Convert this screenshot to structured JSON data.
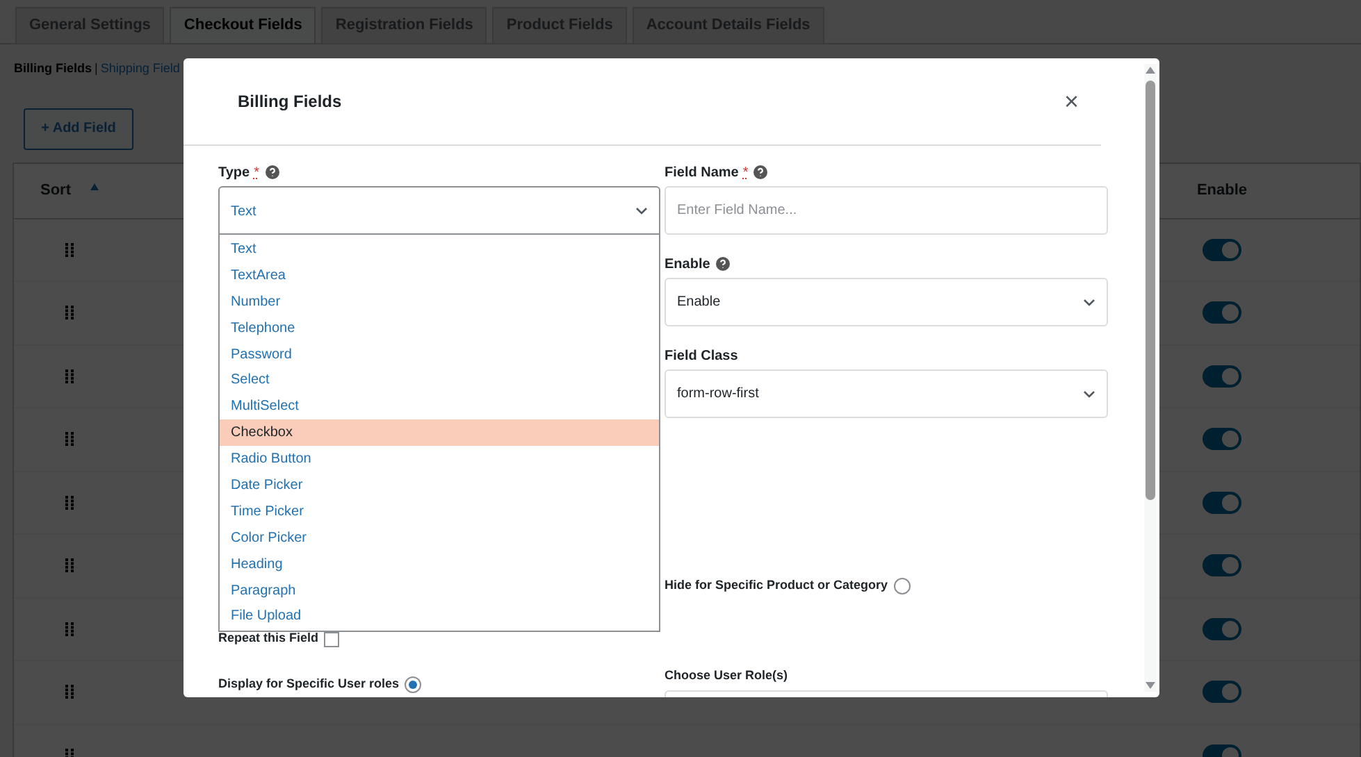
{
  "tabs": [
    {
      "label": "General Settings",
      "selected": false
    },
    {
      "label": "Checkout Fields",
      "selected": true
    },
    {
      "label": "Registration Fields",
      "selected": false
    },
    {
      "label": "Product Fields",
      "selected": false
    },
    {
      "label": "Account Details Fields",
      "selected": false
    }
  ],
  "subnav": [
    {
      "label": "Billing Fields",
      "selected": true
    },
    {
      "label": "Shipping Field",
      "selected": false
    }
  ],
  "subnav_separator": "|",
  "add_button": "+ Add Field",
  "table": {
    "columns": [
      "Sort",
      "Enable"
    ],
    "rows": [
      {
        "enabled": true
      },
      {
        "enabled": true
      },
      {
        "enabled": true
      },
      {
        "enabled": true
      },
      {
        "enabled": true
      },
      {
        "enabled": true
      },
      {
        "enabled": true
      },
      {
        "enabled": true
      },
      {
        "enabled": true
      }
    ]
  },
  "modal": {
    "title": "Billing Fields",
    "close": "×",
    "type_field": {
      "label": "Type",
      "required_mark": "*",
      "help": true,
      "value": "Text",
      "expanded": true,
      "options": [
        {
          "label": "Text",
          "highlighted": false
        },
        {
          "label": "TextArea",
          "highlighted": false
        },
        {
          "label": "Number",
          "highlighted": false
        },
        {
          "label": "Telephone",
          "highlighted": false
        },
        {
          "label": "Password",
          "highlighted": false
        },
        {
          "label": "Select",
          "highlighted": false
        },
        {
          "label": "MultiSelect",
          "highlighted": false
        },
        {
          "label": "Checkbox",
          "highlighted": true
        },
        {
          "label": "Radio Button",
          "highlighted": false
        },
        {
          "label": "Date Picker",
          "highlighted": false
        },
        {
          "label": "Time Picker",
          "highlighted": false
        },
        {
          "label": "Color Picker",
          "highlighted": false
        },
        {
          "label": "Heading",
          "highlighted": false
        },
        {
          "label": "Paragraph",
          "highlighted": false
        },
        {
          "label": "File Upload",
          "highlighted": false
        }
      ]
    },
    "field_name": {
      "label": "Field Name",
      "required_mark": "*",
      "help": true,
      "placeholder": "Enter Field Name..."
    },
    "enable": {
      "label": "Enable",
      "help": true,
      "value": "Enable"
    },
    "field_class": {
      "label": "Field Class",
      "value": "form-row-first"
    },
    "hide_for_product": {
      "label": "Hide for Specific Product or Category",
      "checked": false
    },
    "repeat_field": {
      "label": "Repeat this Field",
      "checked": false
    },
    "display_for_roles": {
      "label": "Display for Specific User roles",
      "checked": true
    },
    "choose_roles": {
      "label": "Choose User Role(s)"
    }
  }
}
